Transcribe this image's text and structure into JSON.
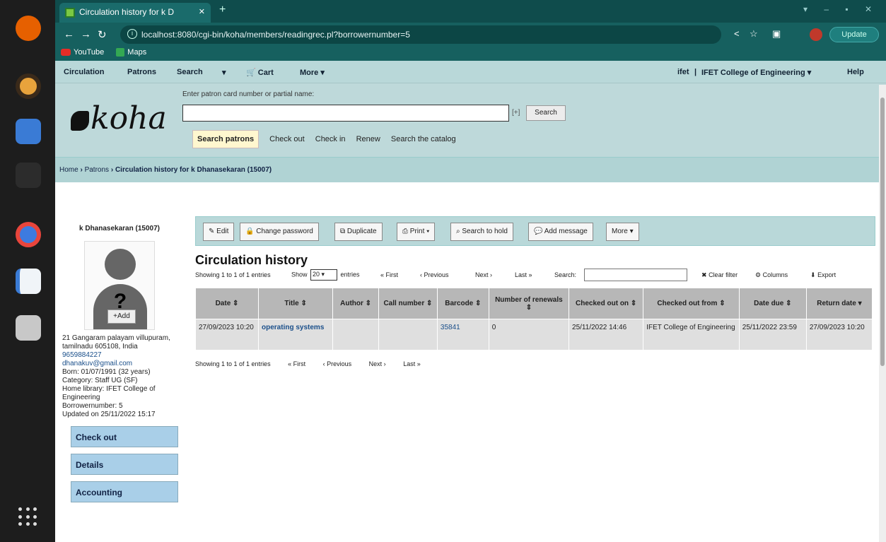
{
  "browser": {
    "tab_title": "Circulation history for k D",
    "url": "localhost:8080/cgi-bin/koha/members/readingrec.pl?borrowernumber=5",
    "update_label": "Update",
    "bookmarks": [
      "YouTube",
      "Maps"
    ]
  },
  "kohanav": {
    "left": [
      "Circulation",
      "Patrons",
      "Search",
      "Cart",
      "More"
    ],
    "right": [
      "ifet",
      "IFET College of Engineering",
      "Help"
    ]
  },
  "header": {
    "logo_text": "koha",
    "search_hint": "Enter patron card number or partial name:",
    "plus": "[+]",
    "search_button": "Search",
    "subtabs": [
      "Search patrons",
      "Check out",
      "Check in",
      "Renew",
      "Search the catalog"
    ]
  },
  "breadcrumb": {
    "home": "Home",
    "patrons": "Patrons",
    "current": "Circulation history for k Dhanasekaran (15007)"
  },
  "patron": {
    "name": "k Dhanasekaran (15007)",
    "add_photo": "+Add",
    "address": "21 Gangaram palayam villupuram, tamilnadu 605108, India",
    "phone": "9659884227",
    "email": "dhanakuv@gmail.com",
    "born": "Born: 01/07/1991 (32 years)",
    "category": "Category: Staff UG (SF)",
    "home_library": "Home library: IFET College of Engineering",
    "borrowernumber": "Borrowernumber: 5",
    "updated": "Updated on 25/11/2022 15:17"
  },
  "side_menu": [
    "Check out",
    "Details",
    "Accounting"
  ],
  "toolbar": [
    "Edit",
    "Change password",
    "Duplicate",
    "Print",
    "Search to hold",
    "Add message",
    "More"
  ],
  "page_title": "Circulation history",
  "dt": {
    "showing": "Showing 1 to 1 of 1 entries",
    "show": "Show",
    "page_size": "20",
    "entries": "entries",
    "first": "« First",
    "previous": "‹ Previous",
    "next": "Next ›",
    "last": "Last »",
    "search_label": "Search:",
    "clear_filter": "Clear filter",
    "columns": "Columns",
    "export": "Export"
  },
  "table": {
    "headers": [
      "Date",
      "Title",
      "Author",
      "Call number",
      "Barcode",
      "Number of renewals",
      "Checked out on",
      "Checked out from",
      "Date due",
      "Return date"
    ],
    "rows": [
      [
        "27/09/2023 10:20",
        "operating systems",
        "",
        "",
        "35841",
        "0",
        "25/11/2022 14:46",
        "IFET College of Engineering",
        "25/11/2022 23:59",
        "27/09/2023 10:20"
      ]
    ]
  },
  "bottom": {
    "showing": "Showing 1 to 1 of 1 entries",
    "first": "« First",
    "previous": "‹ Previous",
    "next": "Next ›",
    "last": "Last »"
  }
}
